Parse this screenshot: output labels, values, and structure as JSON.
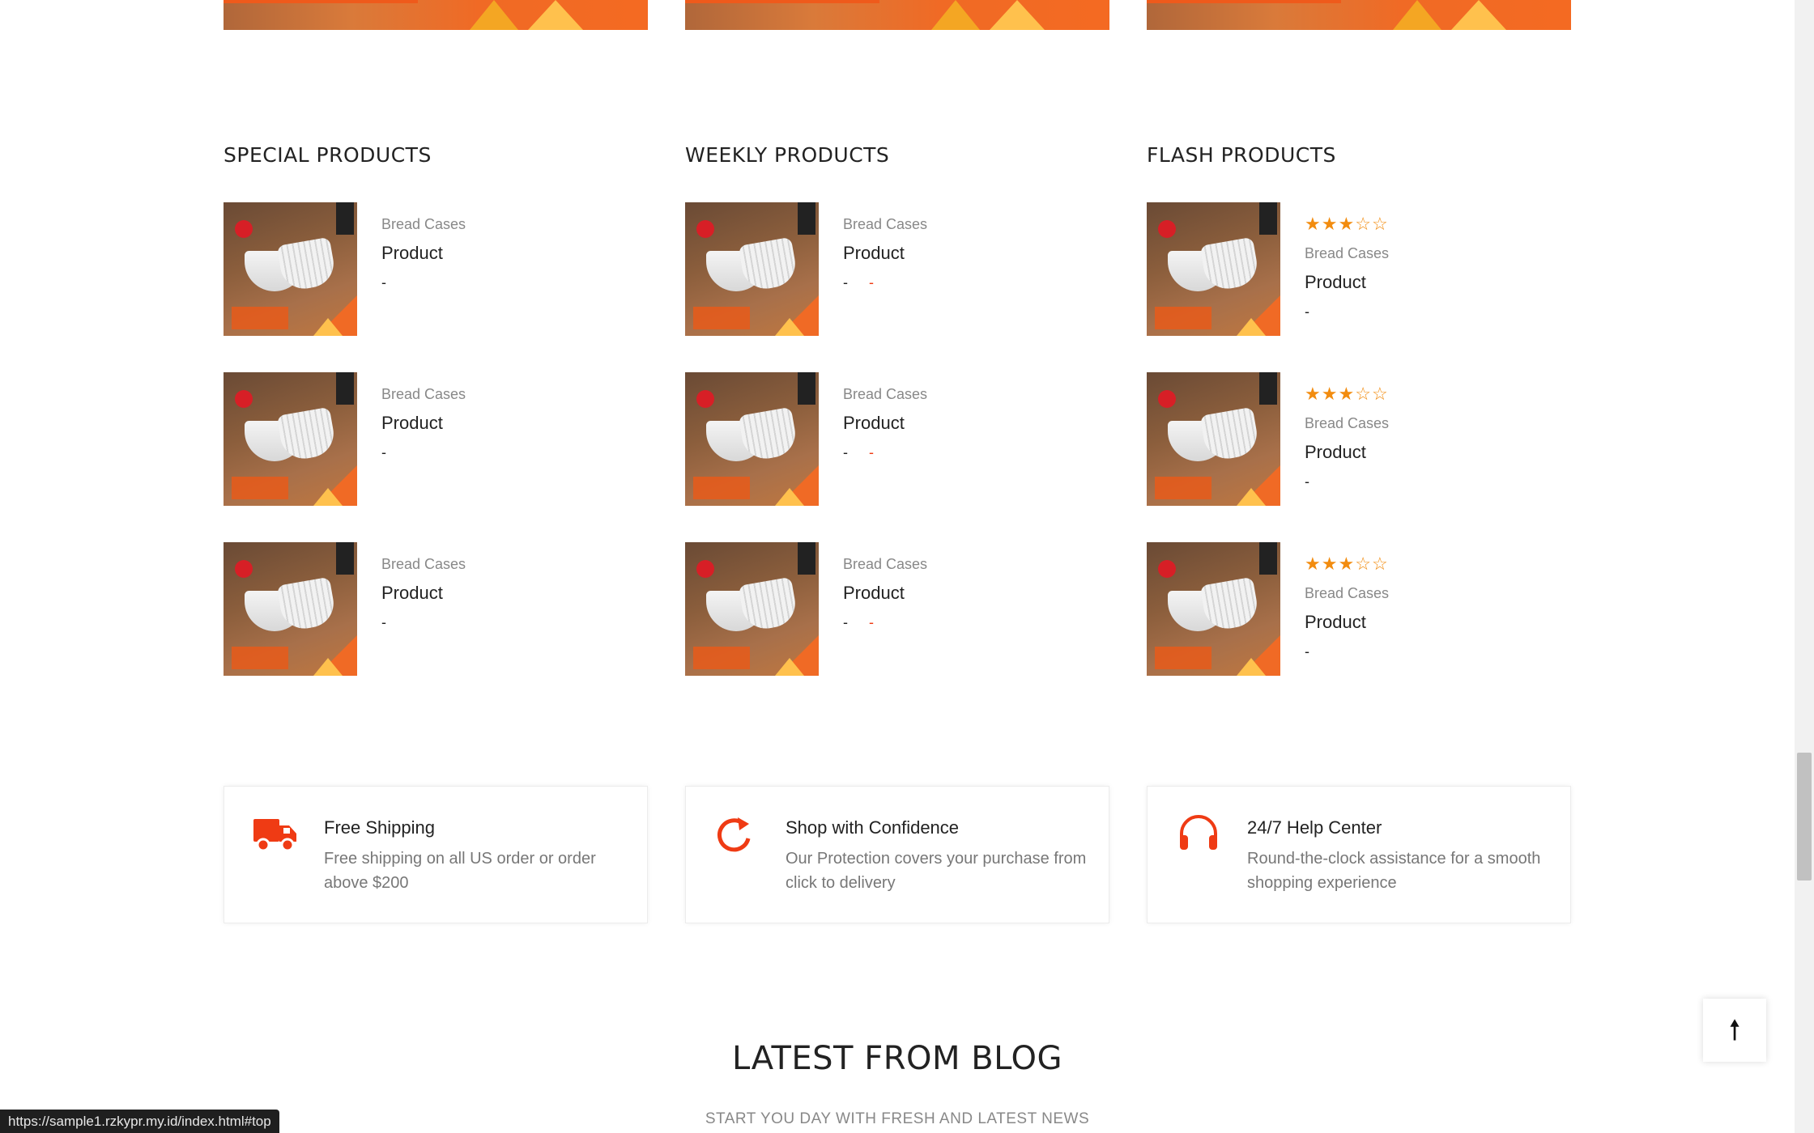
{
  "columns": [
    {
      "title": "SPECIAL PRODUCTS",
      "show_rating": false,
      "show_old_price": false,
      "items": [
        {
          "category": "Bread Cases",
          "name": "Product",
          "price": "-"
        },
        {
          "category": "Bread Cases",
          "name": "Product",
          "price": "-"
        },
        {
          "category": "Bread Cases",
          "name": "Product",
          "price": "-"
        }
      ]
    },
    {
      "title": "WEEKLY PRODUCTS",
      "show_rating": false,
      "show_old_price": true,
      "items": [
        {
          "category": "Bread Cases",
          "name": "Product",
          "price": "-",
          "old_price": "-"
        },
        {
          "category": "Bread Cases",
          "name": "Product",
          "price": "-",
          "old_price": "-"
        },
        {
          "category": "Bread Cases",
          "name": "Product",
          "price": "-",
          "old_price": "-"
        }
      ]
    },
    {
      "title": "FLASH PRODUCTS",
      "show_rating": true,
      "show_old_price": false,
      "items": [
        {
          "rating": 3,
          "rating_max": 5,
          "category": "Bread Cases",
          "name": "Product",
          "price": "-"
        },
        {
          "rating": 3,
          "rating_max": 5,
          "category": "Bread Cases",
          "name": "Product",
          "price": "-"
        },
        {
          "rating": 3,
          "rating_max": 5,
          "category": "Bread Cases",
          "name": "Product",
          "price": "-"
        }
      ]
    }
  ],
  "features": [
    {
      "icon": "truck-icon",
      "title": "Free Shipping",
      "description": "Free shipping on all US order or order above $200"
    },
    {
      "icon": "refresh-icon",
      "title": "Shop with Confidence",
      "description": "Our Protection covers your purchase from click to delivery"
    },
    {
      "icon": "headphones-icon",
      "title": "24/7 Help Center",
      "description": "Round-the-clock assistance for a smooth shopping experience"
    }
  ],
  "blog": {
    "title": "LATEST FROM BLOG",
    "subtitle": "START YOU DAY WITH FRESH AND LATEST NEWS"
  },
  "back_to_top": {
    "icon": "arrow-up-icon",
    "glyph": "🠕"
  },
  "status_url": "https://sample1.rzkypr.my.id/index.html#top",
  "colors": {
    "accent": "#ef3b14",
    "star": "#f28c0f",
    "icon": "#ef3b14"
  }
}
